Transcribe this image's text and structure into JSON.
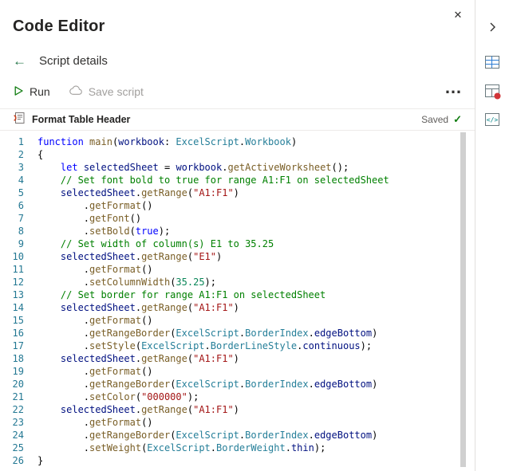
{
  "colors": {
    "accent_green": "#107c10",
    "excel_green": "#217346",
    "disabled_text": "#a19f9d",
    "divider": "#edebe9",
    "title_text": "#252423",
    "body_text": "#323130",
    "muted_text": "#605e5c",
    "line_number": "#237893",
    "notification_red": "#d13438"
  },
  "icons": {
    "close": "✕",
    "back": "←",
    "more": "…",
    "check": "✓"
  },
  "panel": {
    "title": "Code Editor"
  },
  "script_details": {
    "label": "Script details"
  },
  "toolbar": {
    "run_label": "Run",
    "save_label": "Save script"
  },
  "script_header": {
    "name": "Format Table Header",
    "status": "Saved"
  },
  "code": {
    "token_colors": {
      "t": "#000000",
      "k": "#0000ff",
      "c": "#008000",
      "s": "#a31515",
      "n": "#098658",
      "y": "#267f99",
      "v": "#001080",
      "f": "#795e26"
    },
    "lines": [
      [
        [
          "k",
          "function"
        ],
        [
          "t",
          " "
        ],
        [
          "f",
          "main"
        ],
        [
          "t",
          "("
        ],
        [
          "v",
          "workbook"
        ],
        [
          "t",
          ": "
        ],
        [
          "y",
          "ExcelScript"
        ],
        [
          "t",
          "."
        ],
        [
          "y",
          "Workbook"
        ],
        [
          "t",
          ")"
        ]
      ],
      [
        [
          "t",
          "{"
        ]
      ],
      [
        [
          "t",
          "    "
        ],
        [
          "k",
          "let"
        ],
        [
          "t",
          " "
        ],
        [
          "v",
          "selectedSheet"
        ],
        [
          "t",
          " = "
        ],
        [
          "v",
          "workbook"
        ],
        [
          "t",
          "."
        ],
        [
          "f",
          "getActiveWorksheet"
        ],
        [
          "t",
          "();"
        ]
      ],
      [
        [
          "c",
          "    // Set font bold to true for range A1:F1 on selectedSheet"
        ]
      ],
      [
        [
          "t",
          "    "
        ],
        [
          "v",
          "selectedSheet"
        ],
        [
          "t",
          "."
        ],
        [
          "f",
          "getRange"
        ],
        [
          "t",
          "("
        ],
        [
          "s",
          "\"A1:F1\""
        ],
        [
          "t",
          ")"
        ]
      ],
      [
        [
          "t",
          "        ."
        ],
        [
          "f",
          "getFormat"
        ],
        [
          "t",
          "()"
        ]
      ],
      [
        [
          "t",
          "        ."
        ],
        [
          "f",
          "getFont"
        ],
        [
          "t",
          "()"
        ]
      ],
      [
        [
          "t",
          "        ."
        ],
        [
          "f",
          "setBold"
        ],
        [
          "t",
          "("
        ],
        [
          "k",
          "true"
        ],
        [
          "t",
          ");"
        ]
      ],
      [
        [
          "c",
          "    // Set width of column(s) E1 to 35.25"
        ]
      ],
      [
        [
          "t",
          "    "
        ],
        [
          "v",
          "selectedSheet"
        ],
        [
          "t",
          "."
        ],
        [
          "f",
          "getRange"
        ],
        [
          "t",
          "("
        ],
        [
          "s",
          "\"E1\""
        ],
        [
          "t",
          ")"
        ]
      ],
      [
        [
          "t",
          "        ."
        ],
        [
          "f",
          "getFormat"
        ],
        [
          "t",
          "()"
        ]
      ],
      [
        [
          "t",
          "        ."
        ],
        [
          "f",
          "setColumnWidth"
        ],
        [
          "t",
          "("
        ],
        [
          "n",
          "35.25"
        ],
        [
          "t",
          ");"
        ]
      ],
      [
        [
          "c",
          "    // Set border for range A1:F1 on selectedSheet"
        ]
      ],
      [
        [
          "t",
          "    "
        ],
        [
          "v",
          "selectedSheet"
        ],
        [
          "t",
          "."
        ],
        [
          "f",
          "getRange"
        ],
        [
          "t",
          "("
        ],
        [
          "s",
          "\"A1:F1\""
        ],
        [
          "t",
          ")"
        ]
      ],
      [
        [
          "t",
          "        ."
        ],
        [
          "f",
          "getFormat"
        ],
        [
          "t",
          "()"
        ]
      ],
      [
        [
          "t",
          "        ."
        ],
        [
          "f",
          "getRangeBorder"
        ],
        [
          "t",
          "("
        ],
        [
          "y",
          "ExcelScript"
        ],
        [
          "t",
          "."
        ],
        [
          "y",
          "BorderIndex"
        ],
        [
          "t",
          "."
        ],
        [
          "v",
          "edgeBottom"
        ],
        [
          "t",
          ")"
        ]
      ],
      [
        [
          "t",
          "        ."
        ],
        [
          "f",
          "setStyle"
        ],
        [
          "t",
          "("
        ],
        [
          "y",
          "ExcelScript"
        ],
        [
          "t",
          "."
        ],
        [
          "y",
          "BorderLineStyle"
        ],
        [
          "t",
          "."
        ],
        [
          "v",
          "continuous"
        ],
        [
          "t",
          ");"
        ]
      ],
      [
        [
          "t",
          "    "
        ],
        [
          "v",
          "selectedSheet"
        ],
        [
          "t",
          "."
        ],
        [
          "f",
          "getRange"
        ],
        [
          "t",
          "("
        ],
        [
          "s",
          "\"A1:F1\""
        ],
        [
          "t",
          ")"
        ]
      ],
      [
        [
          "t",
          "        ."
        ],
        [
          "f",
          "getFormat"
        ],
        [
          "t",
          "()"
        ]
      ],
      [
        [
          "t",
          "        ."
        ],
        [
          "f",
          "getRangeBorder"
        ],
        [
          "t",
          "("
        ],
        [
          "y",
          "ExcelScript"
        ],
        [
          "t",
          "."
        ],
        [
          "y",
          "BorderIndex"
        ],
        [
          "t",
          "."
        ],
        [
          "v",
          "edgeBottom"
        ],
        [
          "t",
          ")"
        ]
      ],
      [
        [
          "t",
          "        ."
        ],
        [
          "f",
          "setColor"
        ],
        [
          "t",
          "("
        ],
        [
          "s",
          "\"000000\""
        ],
        [
          "t",
          ");"
        ]
      ],
      [
        [
          "t",
          "    "
        ],
        [
          "v",
          "selectedSheet"
        ],
        [
          "t",
          "."
        ],
        [
          "f",
          "getRange"
        ],
        [
          "t",
          "("
        ],
        [
          "s",
          "\"A1:F1\""
        ],
        [
          "t",
          ")"
        ]
      ],
      [
        [
          "t",
          "        ."
        ],
        [
          "f",
          "getFormat"
        ],
        [
          "t",
          "()"
        ]
      ],
      [
        [
          "t",
          "        ."
        ],
        [
          "f",
          "getRangeBorder"
        ],
        [
          "t",
          "("
        ],
        [
          "y",
          "ExcelScript"
        ],
        [
          "t",
          "."
        ],
        [
          "y",
          "BorderIndex"
        ],
        [
          "t",
          "."
        ],
        [
          "v",
          "edgeBottom"
        ],
        [
          "t",
          ")"
        ]
      ],
      [
        [
          "t",
          "        ."
        ],
        [
          "f",
          "setWeight"
        ],
        [
          "t",
          "("
        ],
        [
          "y",
          "ExcelScript"
        ],
        [
          "t",
          "."
        ],
        [
          "y",
          "BorderWeight"
        ],
        [
          "t",
          "."
        ],
        [
          "v",
          "thin"
        ],
        [
          "t",
          ");"
        ]
      ],
      [
        [
          "t",
          "}"
        ]
      ]
    ]
  },
  "rail": {
    "items": [
      "sheet-table-pane",
      "table-alert-pane",
      "code-editor-pane"
    ]
  }
}
